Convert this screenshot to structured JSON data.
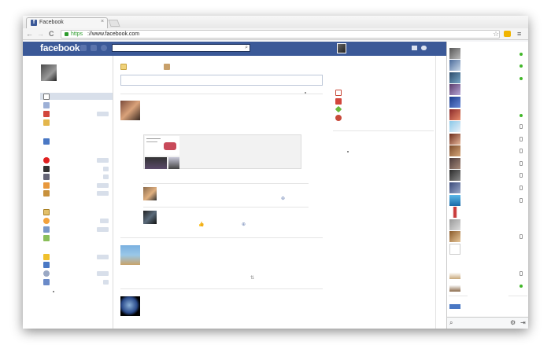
{
  "browser": {
    "tab": {
      "title": "Facebook",
      "favicon": "f",
      "close": "×"
    },
    "toolbar": {
      "back": "←",
      "forward": "→",
      "reload": "C",
      "scheme": "https",
      "host": "://www.facebook.com",
      "star": "☆",
      "menu": "≡"
    }
  },
  "facebook": {
    "logo": "facebook",
    "search": {
      "placeholder": ""
    },
    "search_icon": "⌕",
    "colors": {
      "brand": "#3b5998",
      "online": "#42b72a",
      "count_badge": "#d8dfea"
    }
  },
  "feed": {
    "comment_like_icon": "👍"
  }
}
